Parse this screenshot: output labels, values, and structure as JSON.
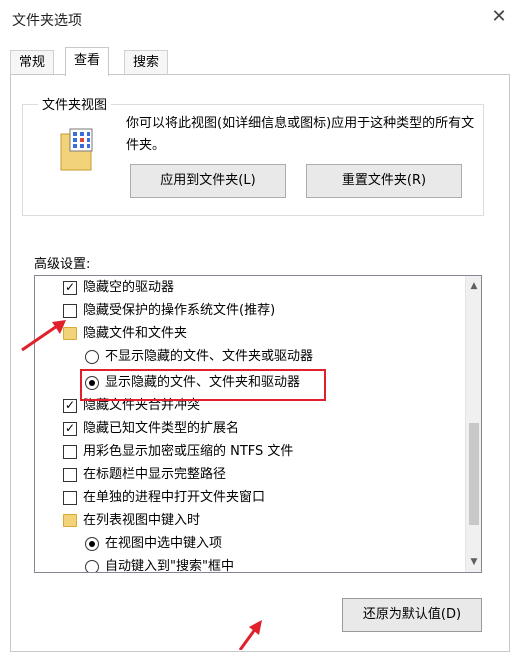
{
  "window": {
    "title": "文件夹选项",
    "close_glyph": "✕"
  },
  "tabs": [
    {
      "label": "常规",
      "active": false
    },
    {
      "label": "查看",
      "active": true
    },
    {
      "label": "搜索",
      "active": false
    }
  ],
  "folder_views": {
    "legend": "文件夹视图",
    "description": "你可以将此视图(如详细信息或图标)应用于这种类型的所有文件夹。",
    "apply_button": "应用到文件夹(L)",
    "reset_button": "重置文件夹(R)"
  },
  "advanced": {
    "label": "高级设置:",
    "items": [
      {
        "type": "checkbox",
        "checked": true,
        "label": "隐藏空的驱动器"
      },
      {
        "type": "checkbox",
        "checked": false,
        "label": "隐藏受保护的操作系统文件(推荐)"
      },
      {
        "type": "folder",
        "label": "隐藏文件和文件夹"
      },
      {
        "type": "radio",
        "checked": false,
        "label": "不显示隐藏的文件、文件夹或驱动器"
      },
      {
        "type": "radio",
        "checked": true,
        "label": "显示隐藏的文件、文件夹和驱动器"
      },
      {
        "type": "checkbox",
        "checked": true,
        "label": "隐藏文件夹合并冲突"
      },
      {
        "type": "checkbox",
        "checked": true,
        "label": "隐藏已知文件类型的扩展名"
      },
      {
        "type": "checkbox",
        "checked": false,
        "label": "用彩色显示加密或压缩的 NTFS 文件"
      },
      {
        "type": "checkbox",
        "checked": false,
        "label": "在标题栏中显示完整路径"
      },
      {
        "type": "checkbox",
        "checked": false,
        "label": "在单独的进程中打开文件夹窗口"
      },
      {
        "type": "folder",
        "label": "在列表视图中键入时"
      },
      {
        "type": "radio",
        "checked": true,
        "label": "在视图中选中键入项"
      },
      {
        "type": "radio",
        "checked": false,
        "label": "自动键入到\"搜索\"框中"
      }
    ]
  },
  "restore_button": "还原为默认值(D)",
  "colors": {
    "annotation_red": "#e0202b",
    "folder_yellow": "#f3d37a"
  }
}
